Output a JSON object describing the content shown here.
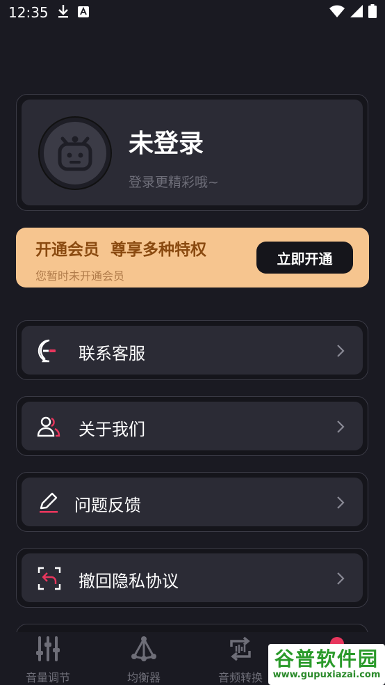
{
  "status_bar": {
    "time": "12:35"
  },
  "profile": {
    "name": "未登录",
    "subtitle": "登录更精彩哦~"
  },
  "vip": {
    "title": "开通会员  尊享多种特权",
    "subtitle": "您暂时未开通会员",
    "button_label": "立即开通"
  },
  "menu": [
    {
      "label": "联系客服",
      "icon": "chat-icon"
    },
    {
      "label": "关于我们",
      "icon": "users-icon"
    },
    {
      "label": "问题反馈",
      "icon": "edit-icon"
    },
    {
      "label": "撤回隐私协议",
      "icon": "revoke-icon"
    }
  ],
  "bottom_nav": [
    {
      "label": "音量调节",
      "icon": "sliders-icon"
    },
    {
      "label": "均衡器",
      "icon": "equalizer-icon"
    },
    {
      "label": "音频转换",
      "icon": "convert-icon"
    }
  ],
  "watermark": {
    "main": "谷普软件园",
    "sub": "www.gupuxiazai.com"
  },
  "colors": {
    "background": "#1a1a22",
    "card": "#2b2b35",
    "vip_bg": "#f6c58f",
    "vip_text": "#8a4a10",
    "accent_red": "#e8365d"
  }
}
